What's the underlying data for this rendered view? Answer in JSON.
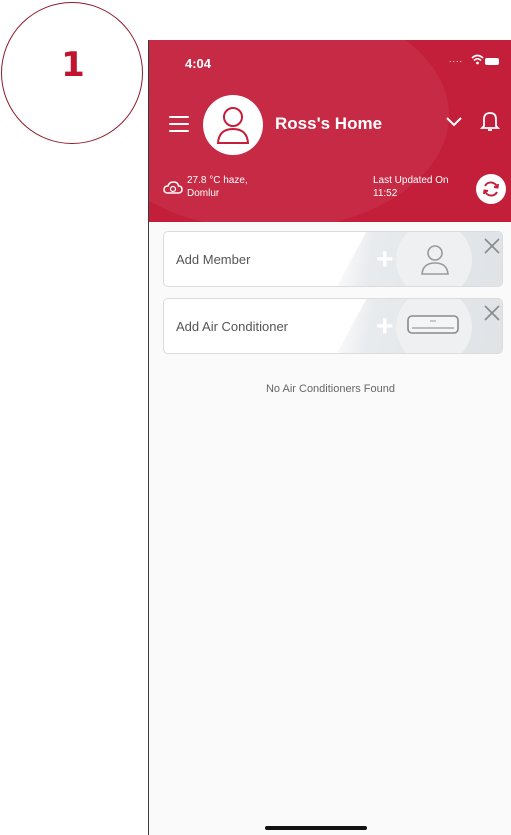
{
  "step": {
    "number": "1"
  },
  "status_bar": {
    "time": "4:04",
    "signal": "...."
  },
  "header": {
    "home_name": "Ross's Home",
    "weather_line1": "27.8 °C haze,",
    "weather_line2": "Domlur",
    "updated_line1": "Last Updated On",
    "updated_line2": "11:52",
    "icons": [
      "menu-icon",
      "avatar-icon",
      "chevron-down-icon",
      "bell-icon",
      "cloud-icon",
      "refresh-icon"
    ]
  },
  "cards": [
    {
      "label": "Add Member",
      "icon": "user-icon"
    },
    {
      "label": "Add Air Conditioner",
      "icon": "air-conditioner-icon"
    }
  ],
  "empty_state": "No Air Conditioners Found",
  "colors": {
    "brand": "#c41f3a",
    "background": "#fafafa"
  }
}
